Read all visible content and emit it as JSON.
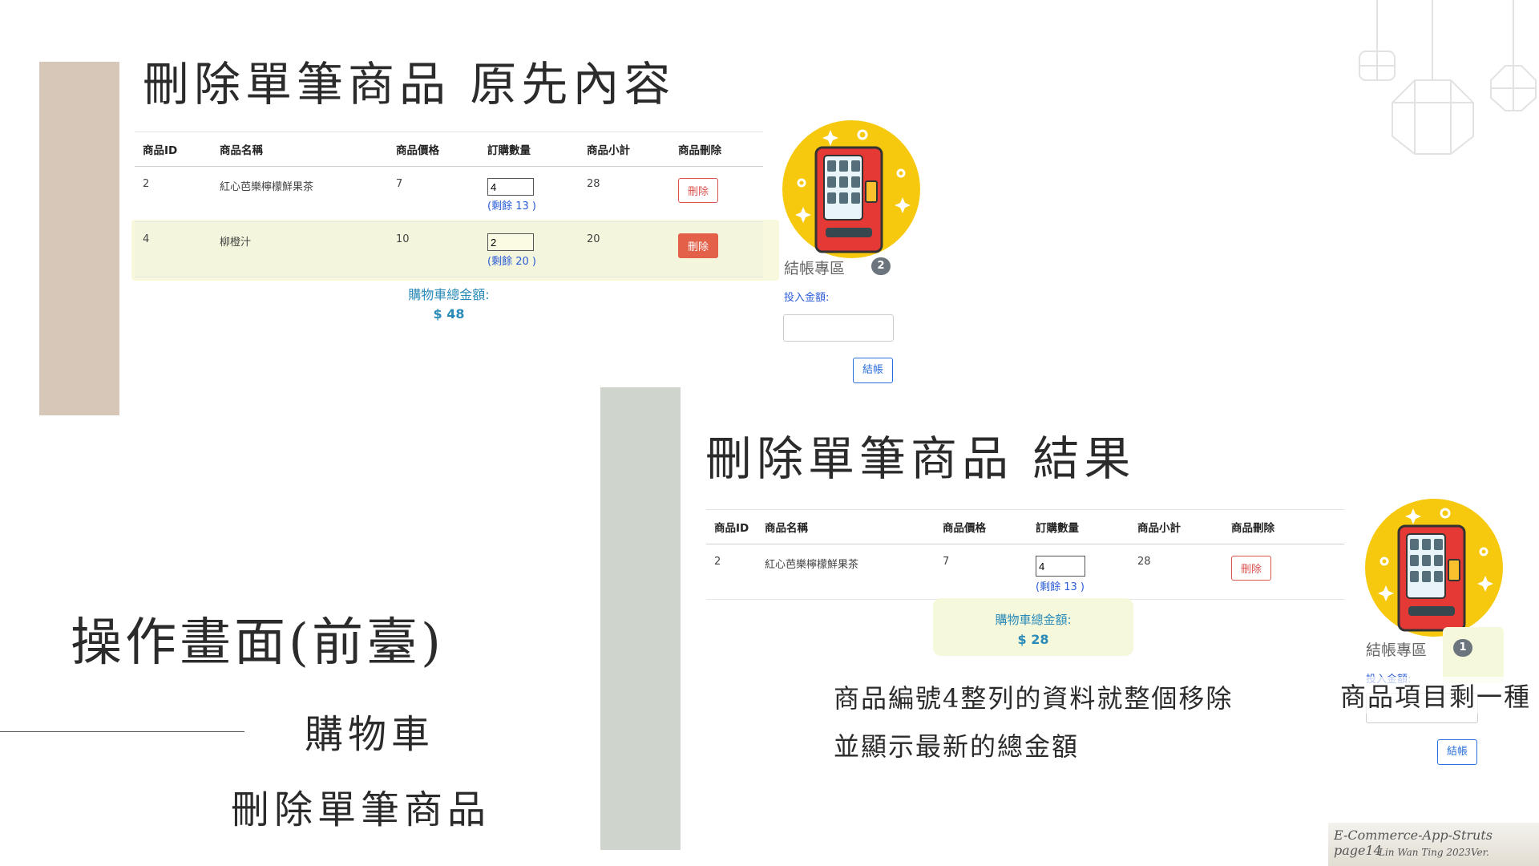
{
  "slide": {
    "title_before": "刪除單筆商品 原先內容",
    "title_after": "刪除單筆商品 結果",
    "main_title": "操作畫面(前臺)",
    "subtitle_1": "購物車",
    "subtitle_2": "刪除單筆商品",
    "note_line_1": "商品編號4整列的資料就整個移除",
    "note_line_2": "並顯示最新的總金額",
    "note_right": "商品項目剩一種",
    "footer_line_1": "E-Commerce-App-Struts page14",
    "footer_line_2": "Lin Wan Ting 2023Ver."
  },
  "cart_headers": [
    "商品ID",
    "商品名稱",
    "商品價格",
    "訂購數量",
    "商品小計",
    "商品刪除"
  ],
  "cart_before": {
    "rows": [
      {
        "id": "2",
        "name": "紅心芭樂檸檬鮮果茶",
        "price": "7",
        "qty": "4",
        "remain": "(剩餘 13 )",
        "subtotal": "28",
        "delete": "刪除"
      },
      {
        "id": "4",
        "name": "柳橙汁",
        "price": "10",
        "qty": "2",
        "remain": "(剩餘 20 )",
        "subtotal": "20",
        "delete": "刪除"
      }
    ],
    "total_label": "購物車總金額:",
    "total_value": "$ 48"
  },
  "cart_after": {
    "rows": [
      {
        "id": "2",
        "name": "紅心芭樂檸檬鮮果茶",
        "price": "7",
        "qty": "4",
        "remain": "(剩餘 13 )",
        "subtotal": "28",
        "delete": "刪除"
      }
    ],
    "total_label": "購物車總金額:",
    "total_value": "$ 28"
  },
  "checkout_before": {
    "title": "結帳專區",
    "badge": "2",
    "pay_label": "投入金額:",
    "button": "結帳"
  },
  "checkout_after": {
    "title": "結帳專區",
    "badge": "1",
    "pay_label": "投入金額:",
    "button": "結帳"
  },
  "colors": {
    "accent_blue": "#2a8ab8",
    "delete_red": "#d9534f",
    "highlight": "#f3f5dc",
    "bar_tan": "#d6c7b8",
    "bar_sage": "#cfd4cc"
  },
  "icons": [
    "vending-machine-icon",
    "geometric-lantern-icon"
  ]
}
